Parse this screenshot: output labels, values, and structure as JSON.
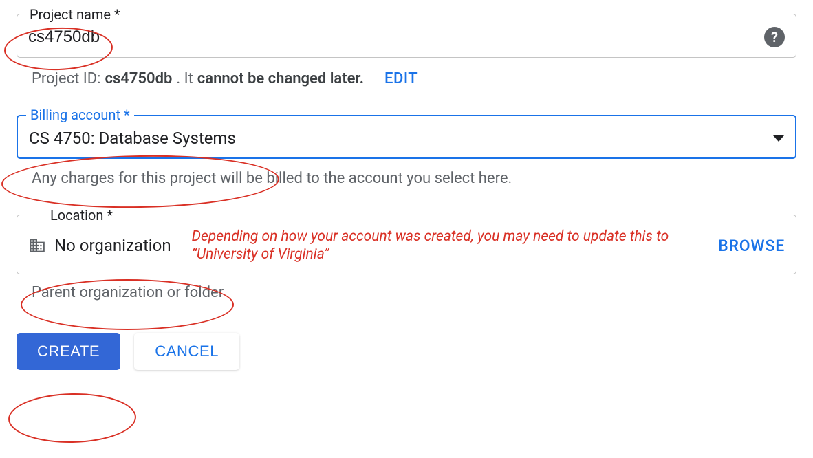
{
  "project_name": {
    "label": "Project name *",
    "value": "cs4750db"
  },
  "project_id": {
    "prefix": "Project ID: ",
    "id_value": "cs4750db",
    "mid": ". It ",
    "warning": "cannot be changed later.",
    "edit_label": "EDIT"
  },
  "billing": {
    "label": "Billing account *",
    "selected": "CS 4750: Database Systems",
    "helper": "Any charges for this project will be billed to the account you select here."
  },
  "location": {
    "label": "Location *",
    "value": "No organization",
    "browse_label": "BROWSE",
    "helper": "Parent organization or folder"
  },
  "annotation": {
    "text": "Depending on how your account was created, you may need to update this to “University of Virginia”"
  },
  "buttons": {
    "create": "CREATE",
    "cancel": "CANCEL"
  }
}
